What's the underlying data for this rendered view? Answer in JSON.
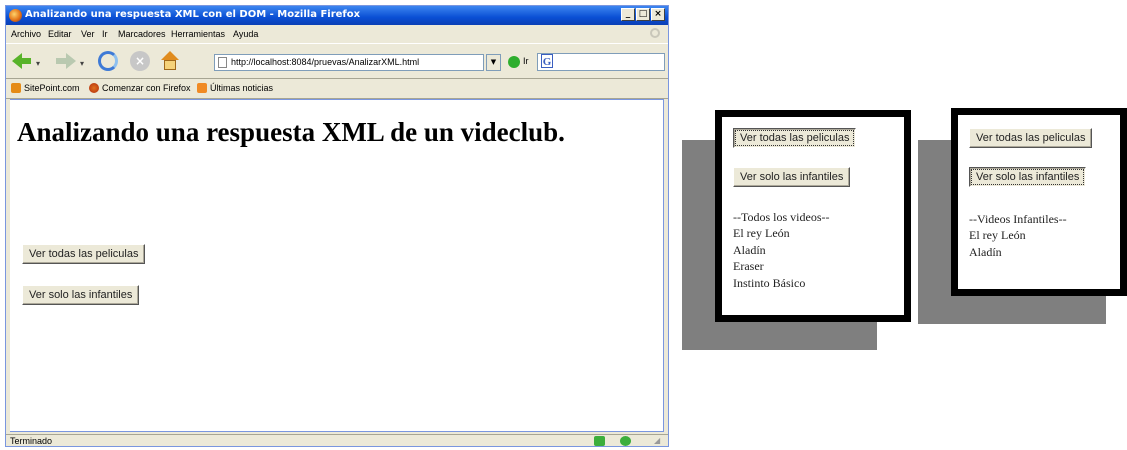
{
  "window": {
    "title": "Analizando una respuesta XML con el DOM - Mozilla Firefox",
    "buttons": {
      "minimize": "_",
      "maximize": "□",
      "close": "×"
    }
  },
  "menu": [
    "Archivo",
    "Editar",
    "Ver",
    "Ir",
    "Marcadores",
    "Herramientas",
    "Ayuda"
  ],
  "navigation": {
    "url": "http://localhost:8084/pruevas/AnalizarXML.html",
    "go_label": "Ir",
    "search_engine_letter": "G"
  },
  "bookmarks": [
    {
      "label": "SitePoint.com",
      "icon": "sitepoint-icon"
    },
    {
      "label": "Comenzar con Firefox",
      "icon": "firefox-icon"
    },
    {
      "label": "Últimas noticias",
      "icon": "rss-icon"
    }
  ],
  "page": {
    "heading": "Analizando una respuesta XML de un videclub.",
    "btn_all": "Ver todas las peliculas",
    "btn_kids": "Ver solo las infantiles"
  },
  "status": {
    "text": "Terminado"
  },
  "panel_all": {
    "btn_all": "Ver todas las peliculas",
    "btn_kids": "Ver solo las infantiles",
    "header": "--Todos los videos--",
    "items": [
      "El rey León",
      "Aladín",
      "Eraser",
      "Instinto Básico"
    ]
  },
  "panel_kids": {
    "btn_all": "Ver todas las peliculas",
    "btn_kids": "Ver solo las infantiles",
    "header": "--Videos Infantiles--",
    "items": [
      "El rey León",
      "Aladín"
    ]
  }
}
